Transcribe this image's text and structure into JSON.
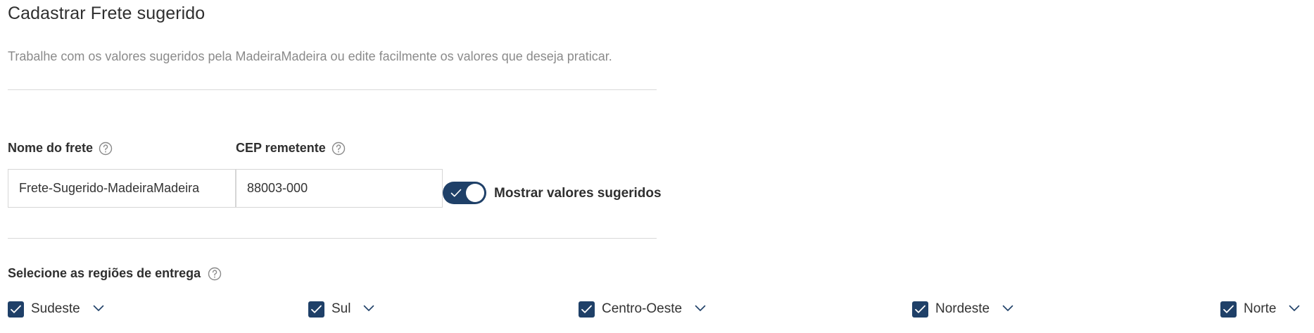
{
  "page": {
    "title": "Cadastrar Frete sugerido",
    "subtitle": "Trabalhe com os valores sugeridos pela MadeiraMadeira ou edite facilmente os valores que deseja praticar."
  },
  "form": {
    "name_label": "Nome do frete",
    "name_value": "Frete-Sugerido-MadeiraMadeira",
    "cep_label": "CEP remetente",
    "cep_value": "88003-000",
    "toggle_label": "Mostrar valores sugeridos",
    "toggle_on": true
  },
  "regions": {
    "label": "Selecione as regiões de entrega",
    "items": [
      {
        "label": "Sudeste",
        "checked": true
      },
      {
        "label": "Sul",
        "checked": true
      },
      {
        "label": "Centro-Oeste",
        "checked": true
      },
      {
        "label": "Nordeste",
        "checked": true
      },
      {
        "label": "Norte",
        "checked": true
      }
    ]
  },
  "colors": {
    "accent": "#1f4068",
    "divider": "#d9d9d9",
    "muted_text": "#8a8a8a"
  },
  "icons": {
    "help": "question-circle-icon",
    "checkbox": "checkmark-icon",
    "expand": "chevron-down-icon"
  }
}
